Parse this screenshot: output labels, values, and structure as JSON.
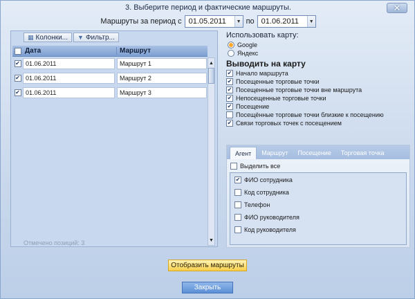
{
  "dialog": {
    "title": "3. Выберите период и фактические маршруты.",
    "close_label": "✕"
  },
  "period": {
    "label": "Маршруты за период с",
    "from": "01.05.2011",
    "to_label": "по",
    "to": "01.06.2011"
  },
  "grid": {
    "toolbar": {
      "columns_label": "Колонки...",
      "filter_label": "Фильтр..."
    },
    "headers": {
      "date": "Дата",
      "route": "Маршрут"
    },
    "rows": [
      {
        "checked": true,
        "date": "01.06.2011",
        "route": "Маршрут 1"
      },
      {
        "checked": true,
        "date": "01.06.2011",
        "route": "Маршрут 2"
      },
      {
        "checked": true,
        "date": "01.06.2011",
        "route": "Маршрут 3"
      }
    ],
    "footer": "Отмечено позиций: 3"
  },
  "map": {
    "use_label": "Использовать карту:",
    "providers": [
      {
        "label": "Google",
        "selected": true
      },
      {
        "label": "Яндекс",
        "selected": false
      }
    ],
    "heading": "Выводить на карту",
    "options": [
      {
        "label": "Начало маршрута",
        "checked": true
      },
      {
        "label": "Посещенные торговые точки",
        "checked": true
      },
      {
        "label": "Посещенные торговые точки вне маршрута",
        "checked": true
      },
      {
        "label": "Непосещенные торговые точки",
        "checked": true
      },
      {
        "label": "Посещение",
        "checked": true
      },
      {
        "label": "Посещённые торговые точки близкие к посещению",
        "checked": false
      },
      {
        "label": "Связи торговых точек с посещением",
        "checked": true
      }
    ]
  },
  "tabs": {
    "items": [
      "Агент",
      "Маршрут",
      "Посещение",
      "Торговая точка"
    ],
    "active": 0,
    "select_all_label": "Выделить все",
    "fields": [
      {
        "label": "ФИО сотрудника",
        "checked": true
      },
      {
        "label": "Код сотрудника",
        "checked": false
      },
      {
        "label": "Телефон",
        "checked": false
      },
      {
        "label": "ФИО руководителя",
        "checked": false
      },
      {
        "label": "Код руководителя",
        "checked": false
      }
    ]
  },
  "buttons": {
    "show_routes": "Отобразить маршруты",
    "close": "Закрыть"
  }
}
